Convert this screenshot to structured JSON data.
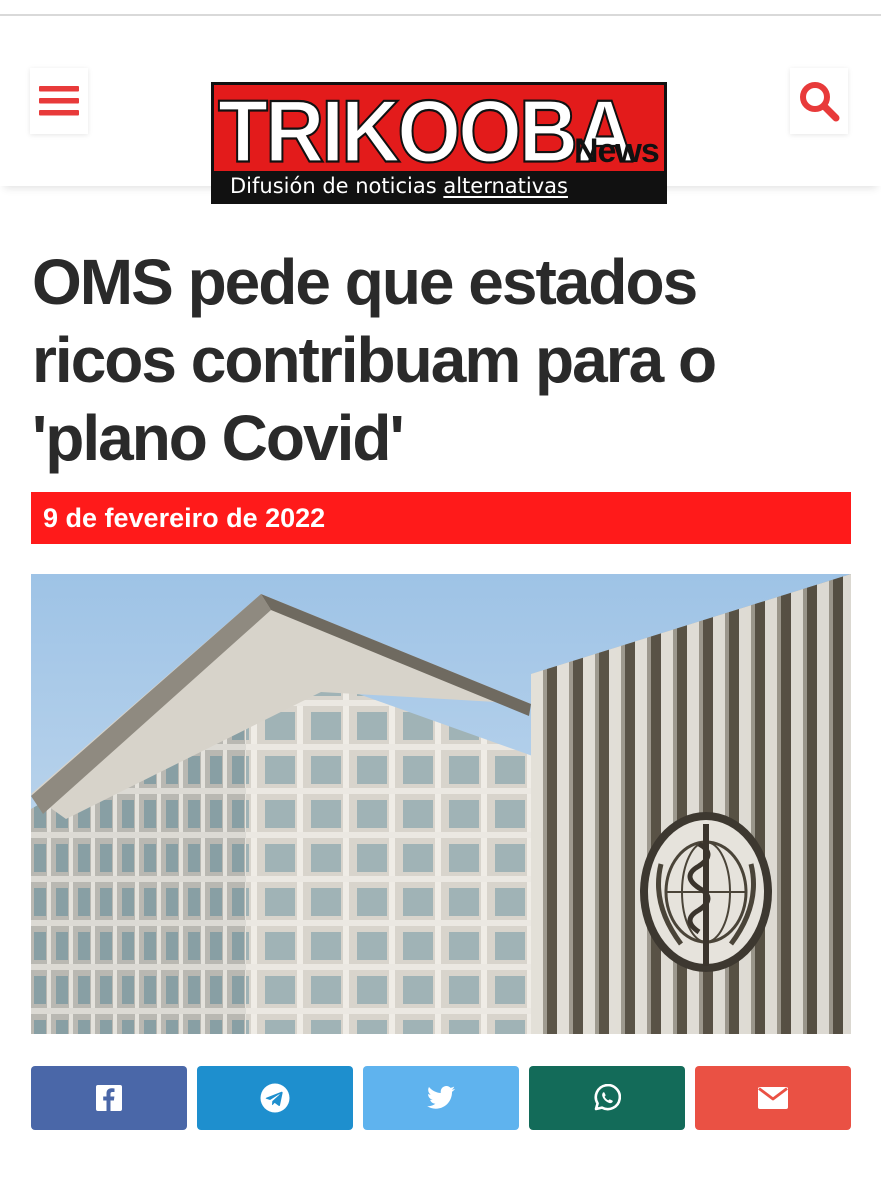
{
  "header": {
    "logo": {
      "brand": "TRIKOOBA",
      "suffix": "News",
      "tagline_prefix": "Difusión de noticias ",
      "tagline_emphasis": "alternativas"
    },
    "menu_icon": "hamburger-menu-icon",
    "search_icon": "search-icon"
  },
  "article": {
    "title": "OMS pede que estados ricos contribuam para o 'plano Covid'",
    "date": "9 de fevereiro de 2022"
  },
  "share": [
    {
      "network": "facebook",
      "icon": "facebook-icon",
      "color": "#4a67a8"
    },
    {
      "network": "telegram",
      "icon": "telegram-icon",
      "color": "#1e8fce"
    },
    {
      "network": "twitter",
      "icon": "twitter-icon",
      "color": "#5fb3ee"
    },
    {
      "network": "whatsapp",
      "icon": "whatsapp-icon",
      "color": "#136b59"
    },
    {
      "network": "email",
      "icon": "email-icon",
      "color": "#ea5144"
    }
  ],
  "colors": {
    "accent": "#ff1a1a",
    "icon_red": "#e83a3a",
    "headline": "#2a2a2a"
  }
}
